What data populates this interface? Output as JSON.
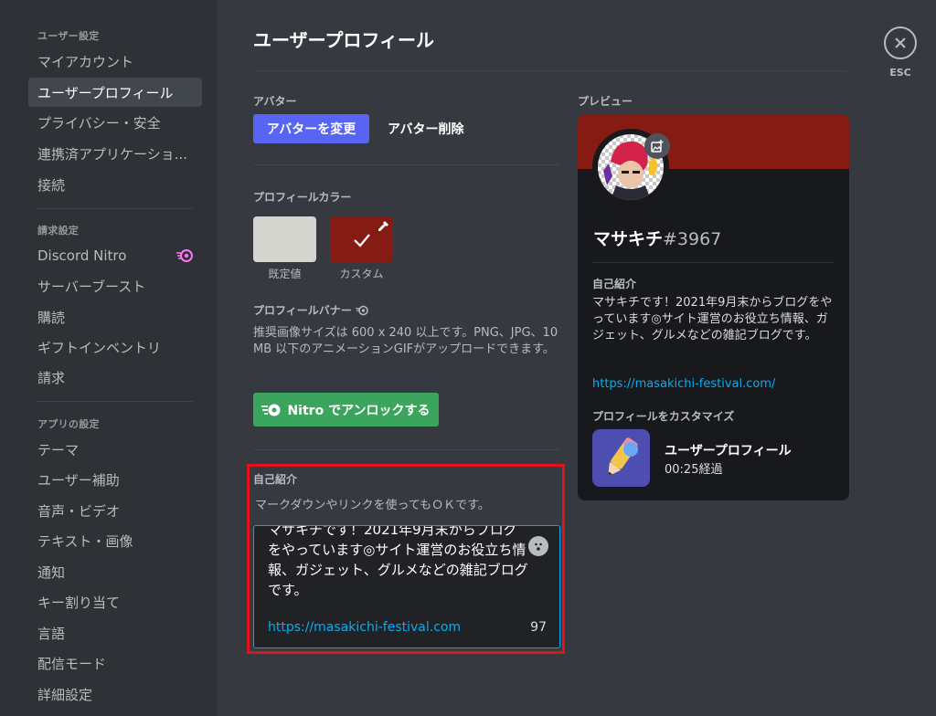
{
  "sidebar": {
    "user_settings_header": "ユーザー設定",
    "user_items": [
      "マイアカウント",
      "ユーザープロフィール",
      "プライバシー・安全",
      "連携済アプリケーショ...",
      "接続"
    ],
    "billing_header": "請求設定",
    "billing_items": [
      "Discord Nitro",
      "サーバーブースト",
      "購読",
      "ギフトインベントリ",
      "請求"
    ],
    "app_header": "アプリの設定",
    "app_items": [
      "テーマ",
      "ユーザー補助",
      "音声・ビデオ",
      "テキスト・画像",
      "通知",
      "キー割り当て",
      "言語",
      "配信モード",
      "詳細設定"
    ]
  },
  "main": {
    "title": "ユーザープロフィール",
    "avatar": {
      "label": "アバター",
      "change_button": "アバターを変更",
      "remove_button": "アバター削除"
    },
    "profile_color": {
      "label": "プロフィールカラー",
      "default_caption": "既定値",
      "custom_caption": "カスタム",
      "default_color": "#d6d6d0",
      "custom_color": "#861b14"
    },
    "banner": {
      "label": "プロフィールバナー",
      "description": "推奨画像サイズは 600 x 240 以上です。PNG、JPG、10 MB 以下のアニメーションGIFがアップロードできます。",
      "unlock_button": "Nitro でアンロックする"
    },
    "bio": {
      "label": "自己紹介",
      "hint": "マークダウンやリンクを使ってもＯＫです。",
      "text": "マサキチです！2021年9月末からブログをやっています◎サイト運営のお役立ち情報、ガジェット、グルメなどの雑記ブログです。",
      "url": "https://masakichi-festival.com",
      "remaining": "97"
    }
  },
  "close": {
    "esc_label": "ESC"
  },
  "preview": {
    "label": "プレビュー",
    "username": "マサキチ",
    "tag": "#3967",
    "bio_label": "自己紹介",
    "bio_text": "マサキチです！2021年9月末からブログをやっています◎サイト運営のお役立ち情報、ガジェット、グルメなどの雑記ブログです。",
    "bio_url": "https://masakichi-festival.com/",
    "customize_label": "プロフィールをカスタマイズ",
    "activity_title": "ユーザープロフィール",
    "activity_time": "00:25経過",
    "banner_color": "#861b14"
  },
  "colors": {
    "blurple": "#5865f2",
    "green": "#3ba55d",
    "link": "#00aff4",
    "highlight": "#e0141b"
  }
}
